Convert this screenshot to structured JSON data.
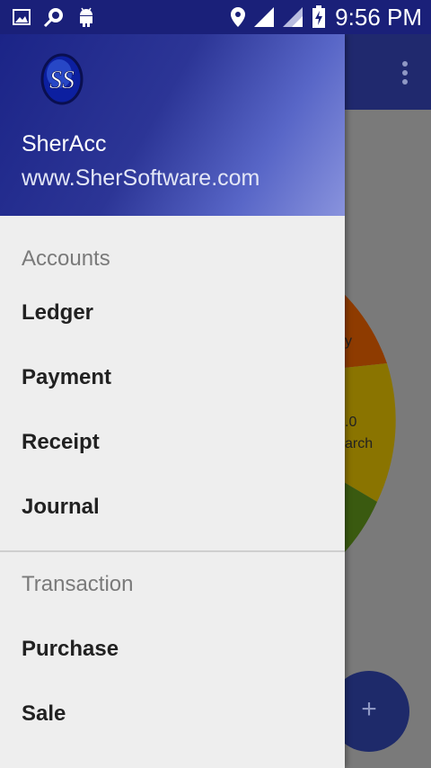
{
  "status_bar": {
    "time": "9:56 PM",
    "icons": [
      "image-icon",
      "search-app-icon",
      "android-icon",
      "location-icon",
      "signal-icon",
      "signal-icon-2",
      "battery-charging-icon"
    ]
  },
  "drawer": {
    "header": {
      "logo_text": "SS",
      "app_name": "SherAcc",
      "url": "www.SherSoftware.com"
    },
    "sections": [
      {
        "title": "Accounts",
        "items": [
          "Ledger",
          "Payment",
          "Receipt",
          "Journal"
        ]
      },
      {
        "title": "Transaction",
        "items": [
          "Purchase",
          "Sale"
        ]
      }
    ]
  },
  "background": {
    "pie_label_1": "y",
    "pie_label_2": ".0",
    "pie_label_3": "arch",
    "fab_label": "+",
    "colors": {
      "pie_red": "#b34a00",
      "pie_yellow": "#b09400",
      "pie_green": "#3e6b00"
    }
  }
}
